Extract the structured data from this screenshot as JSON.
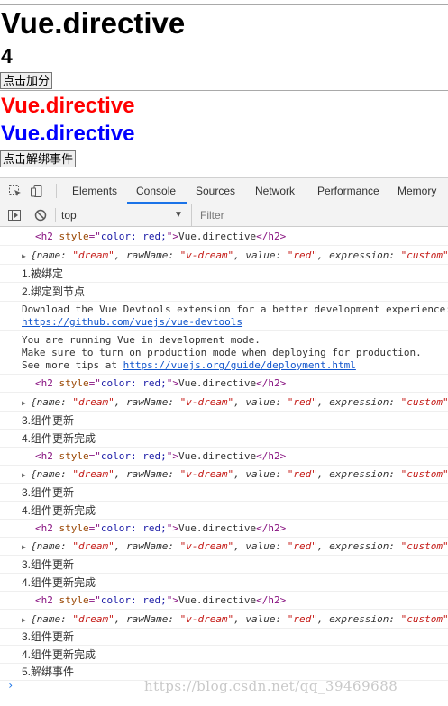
{
  "page": {
    "title1": "Vue.directive",
    "count": "4",
    "add_button": "点击加分",
    "red_title": "Vue.directive",
    "blue_title": "Vue.directive",
    "unbind_button": "点击解绑事件",
    "colors": {
      "red": "#ff0000",
      "blue": "#0000ff"
    }
  },
  "devtools": {
    "tabs": [
      "Elements",
      "Console",
      "Sources",
      "Network",
      "Performance",
      "Memory"
    ],
    "active_tab": "Console",
    "context": "top",
    "filter_placeholder": "Filter",
    "icons": [
      "inspect-element-icon",
      "device-toolbar-icon",
      "sidebar-toggle-icon",
      "clear-console-icon",
      "context-dropdown-arrow-icon"
    ]
  },
  "console": {
    "element": {
      "open": "<h2 ",
      "attr": "style",
      "eq": "=\"",
      "val": "color: red;",
      "close_q": "\">",
      "text": "Vue.directive",
      "end": "</h2>"
    },
    "object": {
      "name_key": "{name: ",
      "name_val": "\"dream\"",
      "raw_key": ", rawName: ",
      "raw_val": "\"v-dream\"",
      "value_key": ", value: ",
      "value_val": "\"red\"",
      "expr_key": ", expression: ",
      "expr_val": "\"custom\""
    },
    "msg_bind": "1.被绑定",
    "msg_inserted": "2.绑定到节点",
    "devtools_msg": "Download the Vue Devtools extension for a better development experience:",
    "devtools_link": "https://github.com/vuejs/vue-devtools",
    "dev_mode_1": "You are running Vue in development mode.",
    "dev_mode_2": "Make sure to turn on production mode when deploying for production.",
    "dev_mode_3_prefix": "See more tips at ",
    "dev_mode_link": "https://vuejs.org/guide/deployment.html",
    "msg_update": "3.组件更新",
    "msg_updated": "4.组件更新完成",
    "msg_unbind": "5.解绑事件",
    "prompt": "›"
  },
  "watermark": "https://blog.csdn.net/qq_39469688"
}
